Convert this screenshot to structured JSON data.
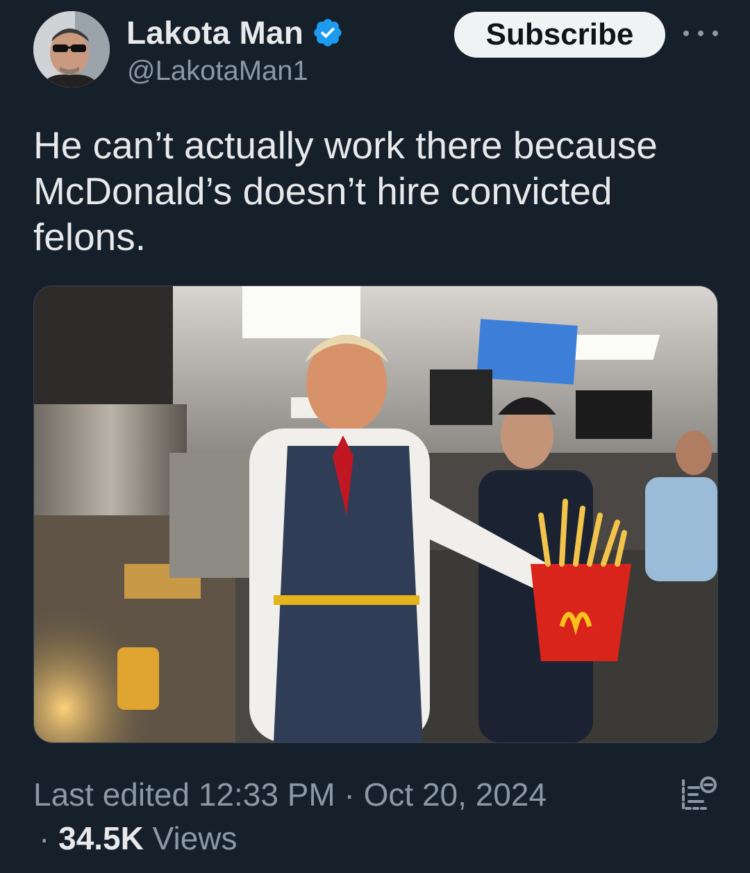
{
  "author": {
    "display_name": "Lakota Man",
    "handle": "@LakotaMan1",
    "verified": true
  },
  "actions": {
    "subscribe_label": "Subscribe",
    "more_icon": "more-horizontal-icon"
  },
  "tweet": {
    "text": "He can’t actually work there because McDonald’s doesn’t hire convicted felons."
  },
  "meta": {
    "last_edited": "Last edited 12:33 PM",
    "separator": "·",
    "date": "Oct 20, 2024",
    "views_count": "34.5K",
    "views_label": "Views"
  },
  "icons": {
    "verified": "verified-badge-icon",
    "analytics": "post-analytics-icon"
  },
  "colors": {
    "background": "#15202b",
    "verified": "#1d9bf0",
    "secondary_text": "#8b98a5",
    "primary_text": "#e7e9ea"
  }
}
